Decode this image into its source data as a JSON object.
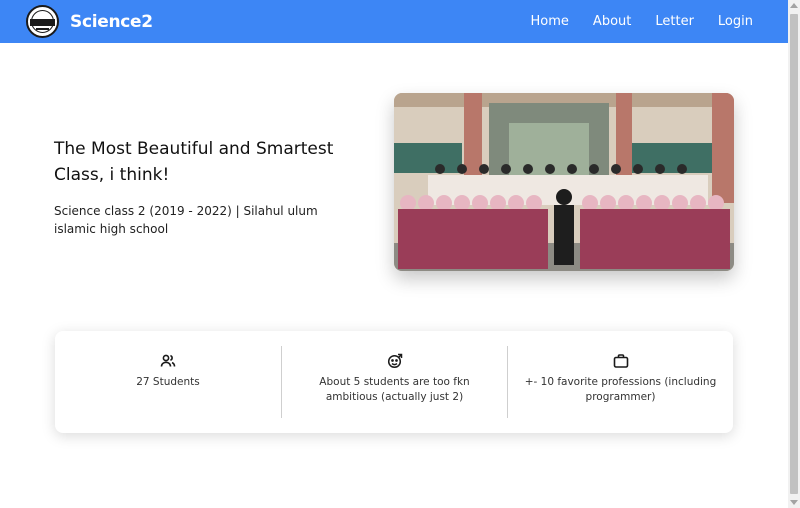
{
  "brand": {
    "name": "Science2"
  },
  "nav": {
    "items": [
      {
        "label": "Home"
      },
      {
        "label": "About"
      },
      {
        "label": "Letter"
      },
      {
        "label": "Login"
      }
    ]
  },
  "hero": {
    "title": "The Most Beautiful and Smartest Class, i think!",
    "subtitle": "Science class 2 (2019 - 2022) | Silahul ulum islamic high school"
  },
  "features": [
    {
      "icon": "users-icon",
      "text": "27 Students"
    },
    {
      "icon": "rocket-face-icon",
      "text": "About 5 students are too fkn ambitious (actually just 2)"
    },
    {
      "icon": "briefcase-icon",
      "text": "+- 10 favorite professions (including programmer)"
    }
  ],
  "colors": {
    "navbar": "#3d86f5",
    "nav_text": "#ffffff",
    "card_bg": "#ffffff"
  }
}
